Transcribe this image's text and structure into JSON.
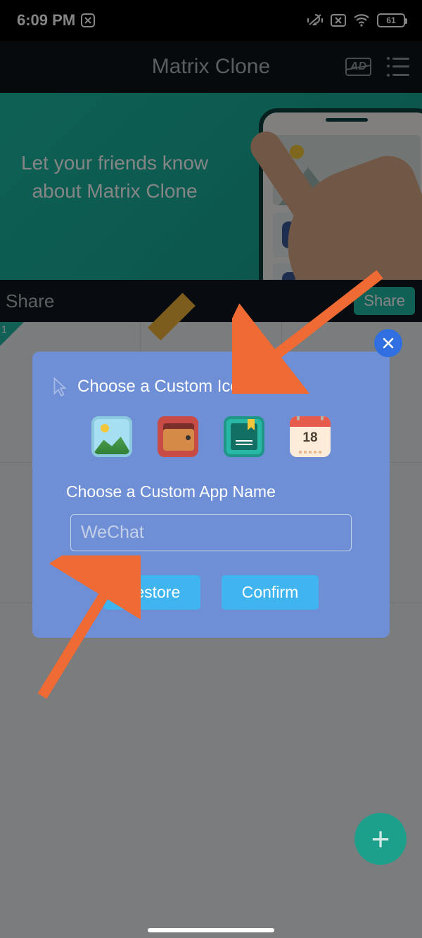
{
  "statusbar": {
    "time": "6:09 PM",
    "battery": "61"
  },
  "titlebar": {
    "title": "Matrix Clone",
    "ad_label": "AD"
  },
  "banner": {
    "line1": "Let your friends know",
    "line2": "about Matrix Clone"
  },
  "sharebar": {
    "label": "Share",
    "button": "Share"
  },
  "grid": {
    "badge1": "1",
    "calendar_number": "18"
  },
  "dialog": {
    "title": "Choose a Custom Icon",
    "subtitle": "Choose a Custom App Name",
    "input_placeholder": "WeChat",
    "restore": "Restore",
    "confirm": "Confirm"
  },
  "colors": {
    "accent_teal": "#1fb8a3",
    "dialog_bg": "#6e8fd6",
    "button_blue": "#3fb4ef",
    "close_blue": "#2f6fe0",
    "arrow": "#f06a33"
  }
}
